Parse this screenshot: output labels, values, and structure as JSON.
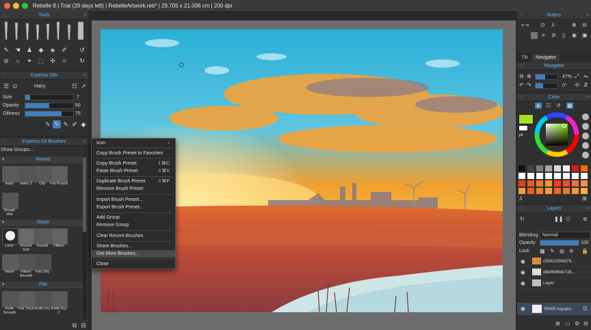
{
  "window": {
    "title": "Rebelle 8 | Trial (29 days left) | RebelleArtwork.reb* | 29.705 x 21.006 cm | 200 dpi"
  },
  "tools_panel": {
    "title": "Tools"
  },
  "express_oils": {
    "title": "Express Oils",
    "brush_name": "Hairy",
    "size_label": "Size",
    "size_value": "7",
    "size_level": 0.1,
    "opacity_label": "Opacity",
    "opacity_value": "50",
    "opacity_level": 0.5,
    "oiliness_label": "Oiliness",
    "oiliness_value": "75",
    "oiliness_level": 0.75
  },
  "brushes_panel": {
    "title": "Express Oil Brushes",
    "show_groups": "Show Groups...",
    "groups": [
      {
        "name": "Round",
        "brushes": [
          "Hairy",
          "Hairy 2",
          "Oily",
          "Fat Round",
          "Rough Wet"
        ]
      },
      {
        "name": "Glaze",
        "brushes": [
          "Liner",
          "Round Soft",
          "Round",
          "Filbert",
          "Wash",
          "Filbert Smooth",
          "Flat Oily"
        ]
      },
      {
        "name": "Flat",
        "brushes": [
          "Knife Smooth",
          "Flat Thick",
          "Knife Dry",
          "Knife Dry 2"
        ]
      }
    ]
  },
  "context_menu": {
    "items": [
      {
        "label": "Icon",
        "shortcut": "",
        "arrow": "›"
      },
      {
        "label": "Copy Brush Preset to Favorites",
        "shortcut": ""
      },
      {
        "label": "Copy Brush Preset",
        "shortcut": "⇧⌘C"
      },
      {
        "label": "Paste Brush Preset",
        "shortcut": "⇧⌘V"
      },
      {
        "label": "Duplicate Brush Preset",
        "shortcut": "⇧⌘P"
      },
      {
        "label": "Remove Brush Preset",
        "shortcut": ""
      },
      {
        "label": "Import Brush Preset...",
        "shortcut": ""
      },
      {
        "label": "Export Brush Preset...",
        "shortcut": ""
      },
      {
        "label": "Add Group",
        "shortcut": ""
      },
      {
        "label": "Remove Group",
        "shortcut": ""
      },
      {
        "label": "Clear Recent Brushes",
        "shortcut": ""
      },
      {
        "label": "Share Brushes...",
        "shortcut": ""
      },
      {
        "label": "Get More Brushes...",
        "shortcut": ""
      },
      {
        "label": "Close",
        "shortcut": ""
      }
    ]
  },
  "rulers_panel": {
    "title": "Rulers"
  },
  "tabs": {
    "tilt": "Tilt",
    "navigator": "Navigator"
  },
  "navigator": {
    "title": "Navigator",
    "zoom": "47%",
    "rotation": "0°"
  },
  "color_panel": {
    "title": "Color",
    "active_color": "#a8e020"
  },
  "layers_panel": {
    "title": "Layers",
    "blending_label": "Blending",
    "blending_value": "Normal",
    "opacity_label": "Opacity",
    "opacity_value": "100",
    "opacity_level": 1.0,
    "lock_label": "Lock",
    "layers": [
      "c5562250fd79...",
      "d8efb96bb7d8...",
      "Layer",
      "RH00 Aquare"
    ]
  },
  "palette": [
    "#111111",
    "#444444",
    "#7a7a7a",
    "#a8a8a8",
    "#d8d8d8",
    "#f0f0f0",
    "#e01818",
    "#ff6a00",
    "#ffffff",
    "#ffffff",
    "#ffffff",
    "#ffffff",
    "#ffffff",
    "#ffffff",
    "#ffffff",
    "#ffffff",
    "#e84020",
    "#f05a20",
    "#f57a20",
    "#f59a20",
    "#ff3a20",
    "#e85030",
    "#f07040",
    "#f59050",
    "#f0a040",
    "#e86020",
    "#f08020",
    "#f5a030",
    "#f06030",
    "#e87a30",
    "#f09a30",
    "#f5b040"
  ]
}
